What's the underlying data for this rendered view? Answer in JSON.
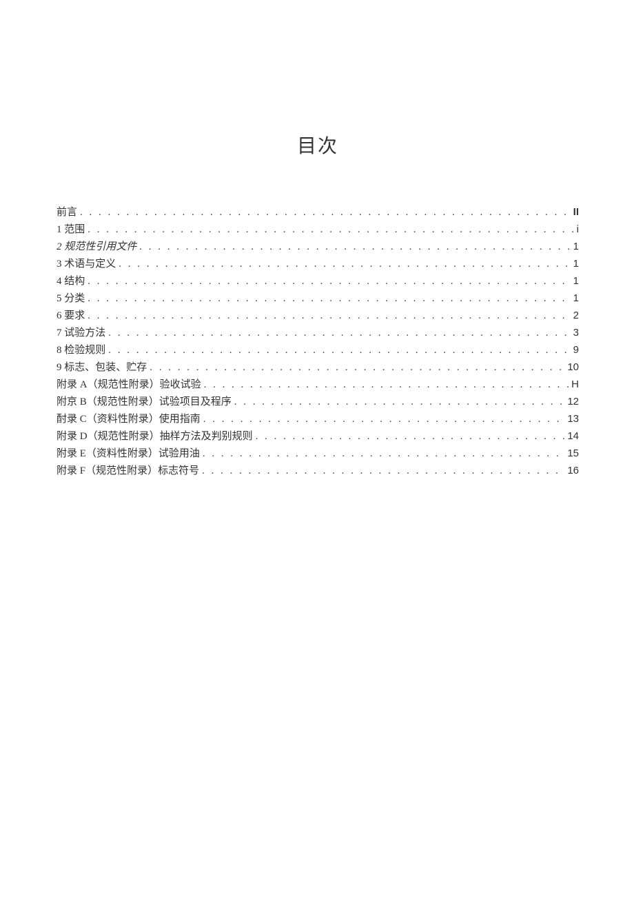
{
  "title": "目次",
  "entries": [
    {
      "label": "前言",
      "page": "II",
      "italic": false,
      "pageBold": true
    },
    {
      "label": "1   范围",
      "page": "i",
      "italic": false,
      "pageBold": false
    },
    {
      "label": "2 规范性引用文件",
      "page": "1",
      "italic": true,
      "pageBold": false
    },
    {
      "label": "3 术语与定义",
      "page": "1",
      "italic": false,
      "pageBold": false
    },
    {
      "label": "4 结构",
      "page": "1",
      "italic": false,
      "pageBold": false
    },
    {
      "label": "5 分类",
      "page": "1",
      "italic": false,
      "pageBold": false
    },
    {
      "label": "6 要求",
      "page": "2",
      "italic": false,
      "pageBold": false
    },
    {
      "label": "7   试验方法",
      "page": "3",
      "italic": false,
      "pageBold": false
    },
    {
      "label": "8 检验规则",
      "page": "9",
      "italic": false,
      "pageBold": false
    },
    {
      "label": "9 标志、包装、贮存",
      "page": "10",
      "italic": false,
      "pageBold": false
    },
    {
      "label": "附录 A（规范性附录）验收试验",
      "page": "H",
      "italic": false,
      "pageBold": false
    },
    {
      "label": "附京 B（规范性附录）试验项目及程序",
      "page": "12",
      "italic": false,
      "pageBold": false
    },
    {
      "label": "酎录 C（资料性附录）使用指南",
      "page": "13",
      "italic": false,
      "pageBold": false
    },
    {
      "label": "附录 D（规范性附录）抽样方法及判别规则",
      "page": "14",
      "italic": false,
      "pageBold": false
    },
    {
      "label": "附录 E（资料性附录）试验用油",
      "page": "15",
      "italic": false,
      "pageBold": false
    },
    {
      "label": "附录 F（规范性附录）标志符号",
      "page": "16",
      "italic": false,
      "pageBold": false
    }
  ]
}
